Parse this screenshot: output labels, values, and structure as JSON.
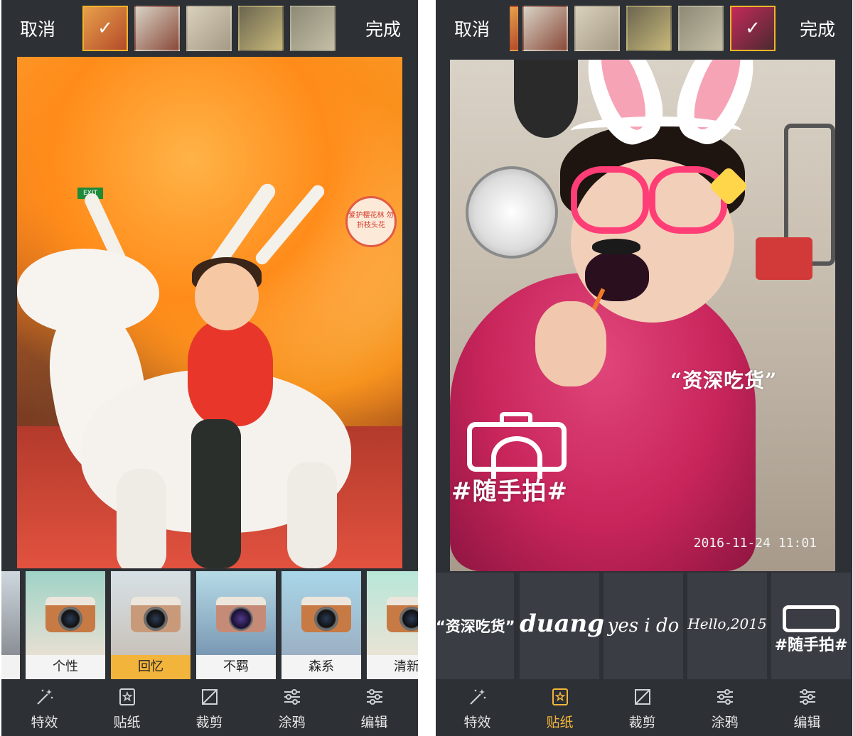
{
  "left": {
    "topbar": {
      "cancel": "取消",
      "done": "完成"
    },
    "filters": [
      {
        "label": "个性"
      },
      {
        "label": "回忆",
        "selected": true
      },
      {
        "label": "不羁"
      },
      {
        "label": "森系"
      },
      {
        "label": "清新"
      }
    ],
    "photo": {
      "sign_text": "爱护樱花林 勿折枝头花"
    }
  },
  "right": {
    "topbar": {
      "cancel": "取消",
      "done": "完成"
    },
    "photo": {
      "sticker_foodie": "“资深吃货”",
      "sticker_snap": "#随手拍#",
      "datestamp": "2016-11-24 11:01"
    },
    "stickers": [
      {
        "text": "“资深吃货”"
      },
      {
        "text": "duang~"
      },
      {
        "text": "yes i do"
      },
      {
        "text": "Hello,2015"
      },
      {
        "text": "#随手拍#"
      }
    ]
  },
  "tabs": [
    {
      "label": "特效",
      "icon": "magic-wand-icon"
    },
    {
      "label": "贴纸",
      "icon": "sticker-icon"
    },
    {
      "label": "裁剪",
      "icon": "crop-icon"
    },
    {
      "label": "涂鸦",
      "icon": "sliders-icon"
    },
    {
      "label": "编辑",
      "icon": "edit-sliders-icon"
    }
  ],
  "colors": {
    "accent": "#f3b43c",
    "bar": "#2d3035"
  }
}
